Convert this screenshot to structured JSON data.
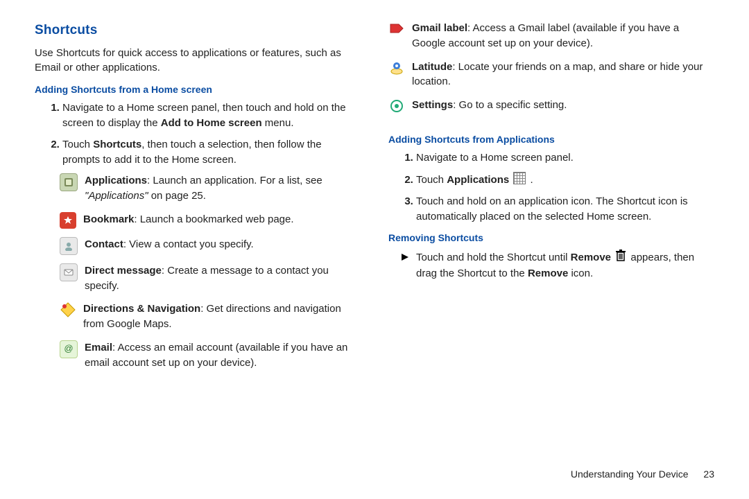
{
  "section_title": "Shortcuts",
  "intro": "Use Shortcuts for quick access to applications or features, such as Email or other applications.",
  "sub_add_home": "Adding Shortcuts from a Home screen",
  "steps_home": {
    "s1a": "Navigate to a Home screen panel, then touch and hold on the screen to display the ",
    "s1b": "Add to Home screen",
    "s1c": " menu.",
    "s2a": "Touch ",
    "s2b": "Shortcuts",
    "s2c": ", then touch a selection, then follow the prompts to add it to the Home screen."
  },
  "icons_left": {
    "apps_b": "Applications",
    "apps_t": ": Launch an application. For a list, see ",
    "apps_i": "\"Applications\"",
    "apps_p": " on page 25.",
    "bookmark_b": "Bookmark",
    "bookmark_t": ": Launch a bookmarked web page.",
    "contact_b": "Contact",
    "contact_t": ": View a contact you specify.",
    "direct_b": "Direct message",
    "direct_t": ": Create a message to a contact you specify.",
    "nav_b": "Directions & Navigation",
    "nav_t": ": Get directions and navigation from Google Maps.",
    "email_b": "Email",
    "email_t": ": Access an email account (available if you have an email account set up on your device)."
  },
  "icons_right": {
    "gmail_b": "Gmail label",
    "gmail_t": ": Access a Gmail label (available if you have a Google account set up on your device).",
    "lat_b": "Latitude",
    "lat_t": ": Locate your friends on a map, and share or hide your location.",
    "set_b": "Settings",
    "set_t": ": Go to a specific setting."
  },
  "sub_add_apps": "Adding Shortcuts from Applications",
  "steps_apps": {
    "s1": "Navigate to a Home screen panel.",
    "s2a": "Touch ",
    "s2b": "Applications",
    "s2c": " .",
    "s3": "Touch and hold on an application icon. The Shortcut icon is automatically placed on the selected Home screen."
  },
  "sub_remove": "Removing Shortcuts",
  "remove": {
    "a": "Touch and hold the Shortcut until ",
    "b": "Remove",
    "c": " appears, then drag the Shortcut to the ",
    "d": "Remove",
    "e": " icon."
  },
  "footer_text": "Understanding Your Device",
  "footer_page": "23"
}
